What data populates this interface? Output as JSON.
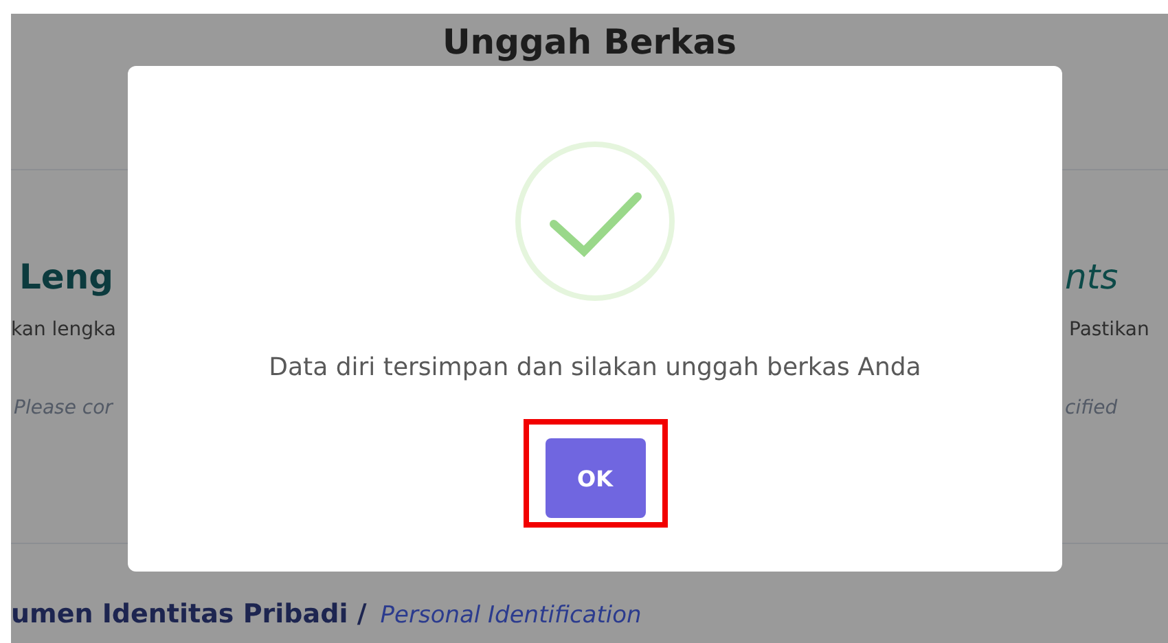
{
  "page": {
    "title": "Unggah Berkas",
    "left": {
      "heading": "Leng",
      "text": "kan lengka",
      "note": "Please cor"
    },
    "right": {
      "heading": "nts",
      "text": "Pastikan",
      "note": "cified"
    },
    "section": {
      "title": "umen Identitas Pribadi /",
      "subtitle": "Personal Identification"
    }
  },
  "dialog": {
    "message": "Data diri tersimpan dan silakan unggah berkas Anda",
    "button": "OK"
  }
}
